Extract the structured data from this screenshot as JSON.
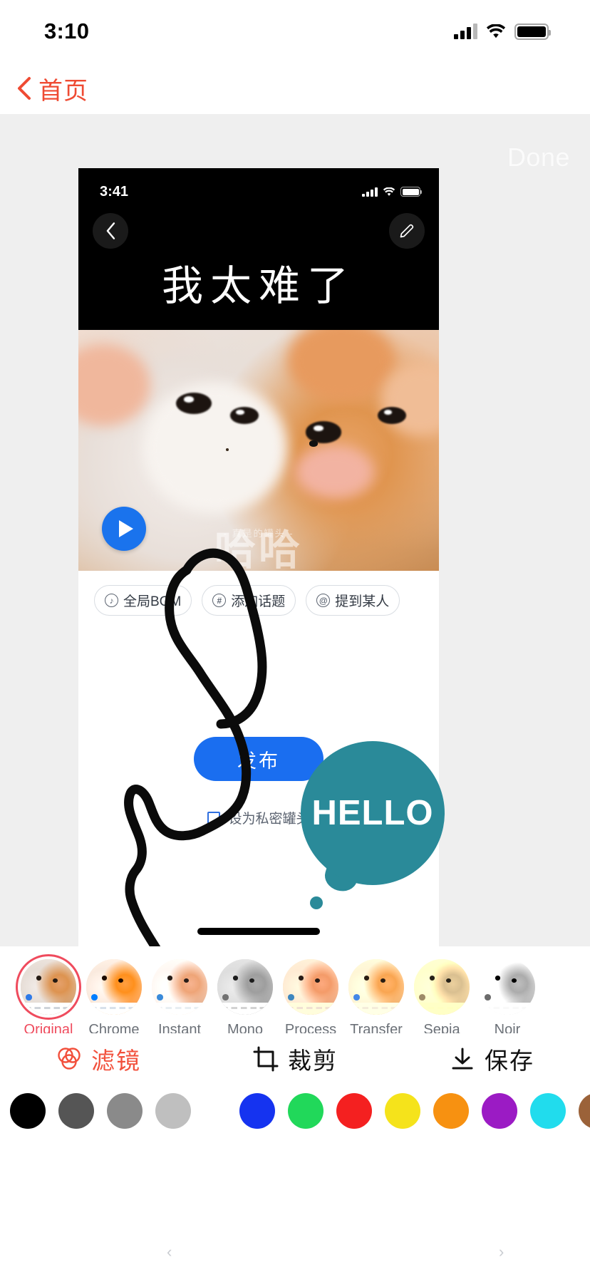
{
  "status_bar": {
    "time": "3:10",
    "signal_icon": "cellular-signal-icon",
    "wifi_icon": "wifi-icon",
    "battery_icon": "battery-icon"
  },
  "nav": {
    "back_label": "首页",
    "back_icon": "chevron-left-icon",
    "accent_color": "#ef4b33"
  },
  "editor": {
    "done_label": "Done",
    "canvas_background": "#efefef"
  },
  "photo": {
    "inner_status_time": "3:41",
    "back_icon": "chevron-left-icon",
    "edit_icon": "pencil-icon",
    "headline": "我太难了",
    "play_icon": "play-icon",
    "watermark_small": "- 真是的罐头 -",
    "watermark_big": "哈哈",
    "chips": [
      {
        "icon": "music-note-icon",
        "glyph": "♪",
        "label": "全局BGM"
      },
      {
        "icon": "hash-icon",
        "glyph": "#",
        "label": "添加话题"
      },
      {
        "icon": "at-mention-icon",
        "glyph": "@",
        "label": "提到某人"
      }
    ],
    "publish_label": "发布",
    "publish_color": "#1a6ef0",
    "privacy_label": "设为私密罐头",
    "privacy_checked": false
  },
  "sticker": {
    "text": "HELLO",
    "color": "#2a8a99"
  },
  "filters": {
    "selected": "Original",
    "selection_color": "#ef4b5d",
    "items": [
      {
        "label": "Original"
      },
      {
        "label": "Chrome"
      },
      {
        "label": "Instant"
      },
      {
        "label": "Mono"
      },
      {
        "label": "Process"
      },
      {
        "label": "Transfer"
      },
      {
        "label": "Sepia"
      },
      {
        "label": "Noir"
      }
    ]
  },
  "tools": [
    {
      "name": "filter",
      "icon": "filter-rings-icon",
      "label": "滤镜",
      "color": "#f2503c"
    },
    {
      "name": "crop",
      "icon": "crop-icon",
      "label": "裁剪",
      "color": "#111111"
    },
    {
      "name": "save",
      "icon": "download-icon",
      "label": "保存",
      "color": "#111111"
    }
  ],
  "palette": {
    "grayscale": [
      "#000000",
      "#555555",
      "#8a8a8a",
      "#bfbfbf"
    ],
    "colors": [
      "#1533f0",
      "#21d85a",
      "#f42020",
      "#f5e31b",
      "#f79111",
      "#9b1bc4",
      "#21dced",
      "#9b6239",
      "#f21bc4"
    ]
  }
}
